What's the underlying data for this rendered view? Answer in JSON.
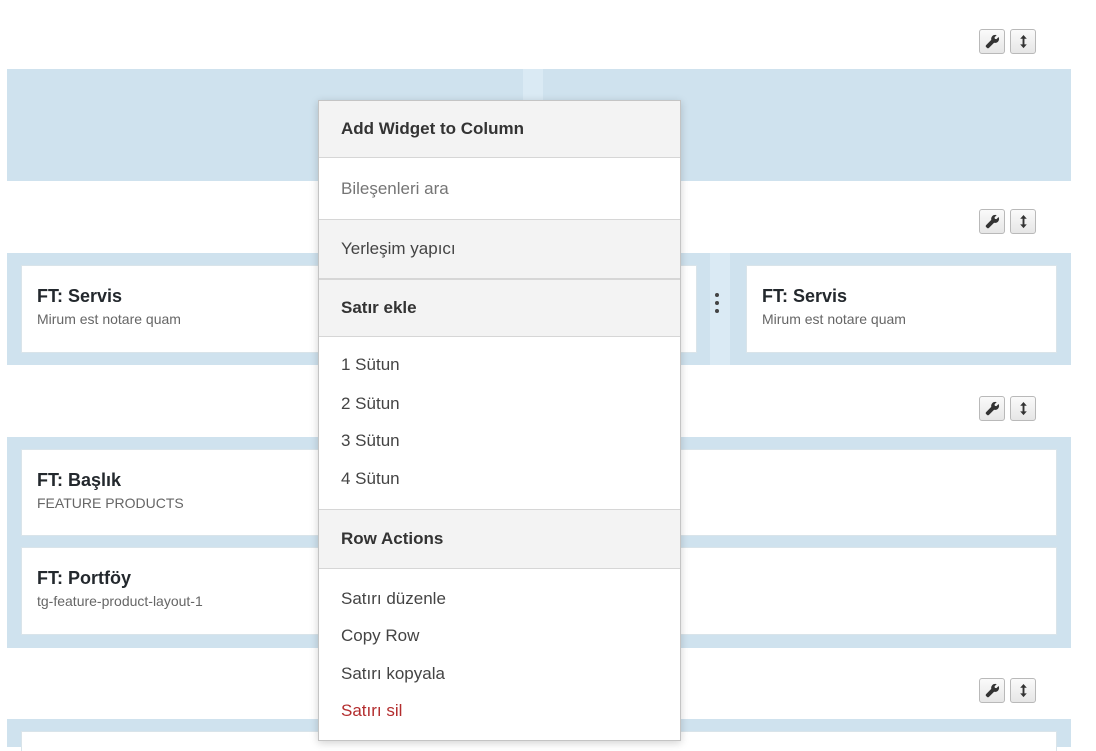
{
  "rows": [
    {
      "widgets": []
    },
    {
      "widgets": [
        {
          "title": "FT: Servis",
          "desc": "Mirum est notare quam"
        },
        {
          "title": "FT: Servis",
          "desc": "Mirum est notare quam"
        }
      ]
    },
    {
      "widgets": [
        {
          "title": "FT: Başlık",
          "desc": "FEATURE PRODUCTS"
        },
        {
          "title": "FT: Portföy",
          "desc": "tg-feature-product-layout-1"
        }
      ]
    }
  ],
  "context_menu": {
    "header_add_widget": "Add Widget to Column",
    "search_placeholder": "Bileşenleri ara",
    "layout_builder": "Yerleşim yapıcı",
    "header_add_row": "Satır ekle",
    "columns": [
      "1 Sütun",
      "2 Sütun",
      "3 Sütun",
      "4 Sütun"
    ],
    "header_row_actions": "Row Actions",
    "actions": [
      "Satırı düzenle",
      "Copy Row",
      "Satırı kopyala"
    ],
    "delete_row": "Satırı sil"
  },
  "colors": {
    "row_background": "#cfe2ee",
    "danger": "#b32d2e"
  },
  "icons": [
    "wrench-icon",
    "move-vertical-icon",
    "drag-handle-icon"
  ]
}
